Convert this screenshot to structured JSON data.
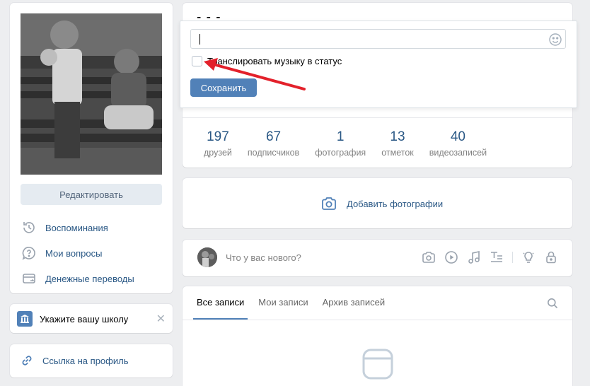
{
  "profile": {
    "name_partial": "- - -",
    "edit_label": "Редактировать",
    "menu": [
      {
        "label": "Воспоминания",
        "icon": "history-icon"
      },
      {
        "label": "Мои вопросы",
        "icon": "question-bubble-icon"
      },
      {
        "label": "Денежные переводы",
        "icon": "card-transfer-icon"
      }
    ],
    "school_label": "Укажите вашу школу",
    "school_close": "✕",
    "link_label": "Ссылка на профиль"
  },
  "status_editor": {
    "input_value": "",
    "music_label": "Транслировать музыку в статус",
    "music_checked": false,
    "save_label": "Сохранить"
  },
  "counters": [
    {
      "num": "197",
      "label": "друзей"
    },
    {
      "num": "67",
      "label": "подписчиков"
    },
    {
      "num": "1",
      "label": "фотография"
    },
    {
      "num": "13",
      "label": "отметок"
    },
    {
      "num": "40",
      "label": "видеозаписей"
    }
  ],
  "photos": {
    "add_label": "Добавить фотографии"
  },
  "post": {
    "placeholder": "Что у вас нового?"
  },
  "wall": {
    "tabs": [
      {
        "label": "Все записи",
        "active": true
      },
      {
        "label": "Мои записи",
        "active": false
      },
      {
        "label": "Архив записей",
        "active": false
      }
    ]
  },
  "colors": {
    "accent": "#5181b8",
    "link": "#2a5885",
    "arrow": "#e3212b",
    "background": "#edeef0"
  }
}
